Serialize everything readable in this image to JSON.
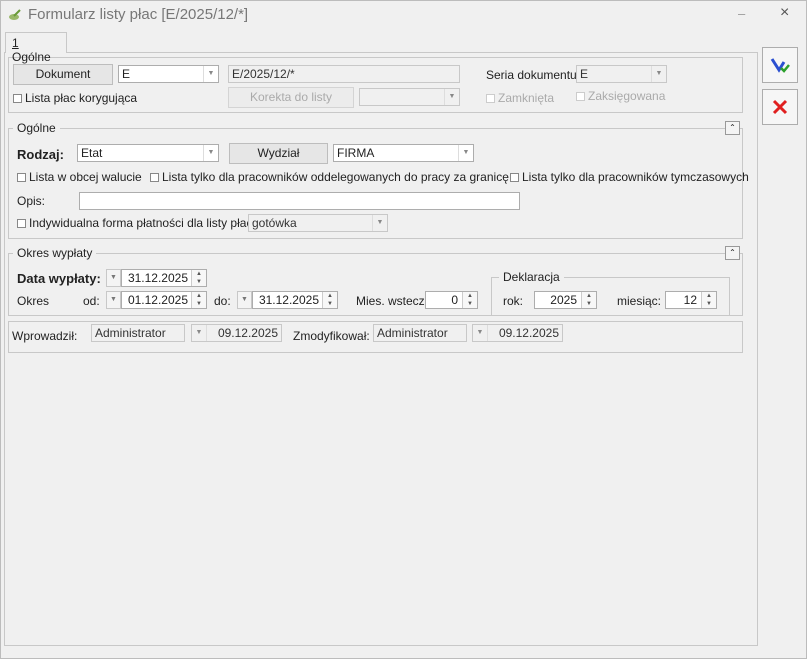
{
  "window": {
    "title": "Formularz listy płac [E/2025/12/*]",
    "minimize": "–",
    "close": "×"
  },
  "tab": {
    "number": "1",
    "label": "Ogólne"
  },
  "document": {
    "dokument_button": "Dokument",
    "symbol_value": "E",
    "number_value": "E/2025/12/*",
    "seria_label": "Seria dokumentu:",
    "seria_value": "E",
    "korygujaca_label": "Lista płac korygująca",
    "korekta_button": "Korekta do listy",
    "korekta_value": "",
    "zamknieta_label": "Zamknięta",
    "zaksiegowana_label": "Zaksięgowana"
  },
  "ogolne": {
    "title": "Ogólne",
    "rodzaj_label": "Rodzaj:",
    "rodzaj_value": "Etat",
    "wydzial_button": "Wydział",
    "wydzial_value": "FIRMA",
    "waluta_label": "Lista w obcej walucie",
    "oddelegowani_label": "Lista tylko dla pracowników oddelegowanych do pracy za granicę",
    "tymczasowi_label": "Lista tylko dla pracowników tymczasowych",
    "opis_label": "Opis:",
    "opis_value": "",
    "platnosc_label": "Indywidualna forma płatności dla listy płac:",
    "platnosc_value": "gotówka"
  },
  "okres": {
    "title": "Okres wypłaty",
    "data_label": "Data wypłaty:",
    "data_value": "31.12.2025",
    "okres_label": "Okres",
    "od_label": "od:",
    "od_value": "01.12.2025",
    "do_label": "do:",
    "do_value": "31.12.2025",
    "mies_label": "Mies. wstecz:",
    "mies_value": "0",
    "deklaracja_title": "Deklaracja",
    "rok_label": "rok:",
    "rok_value": "2025",
    "miesiac_label": "miesiąc:",
    "miesiac_value": "12"
  },
  "audit": {
    "wprowadzil_label": "Wprowadził:",
    "wprowadzil_user": "Administrator",
    "wprowadzil_date": "09.12.2025",
    "zmodyfikowal_label": "Zmodyfikował:",
    "zmodyfikowal_user": "Administrator",
    "zmodyfikowal_date": "09.12.2025"
  },
  "actions": {
    "save_icon": "save-disk-icon",
    "cancel_icon": "red-x-icon"
  },
  "colors": {
    "cancel": "#e02020",
    "save": "#2a4fd0",
    "save_check": "#2ca02c"
  }
}
